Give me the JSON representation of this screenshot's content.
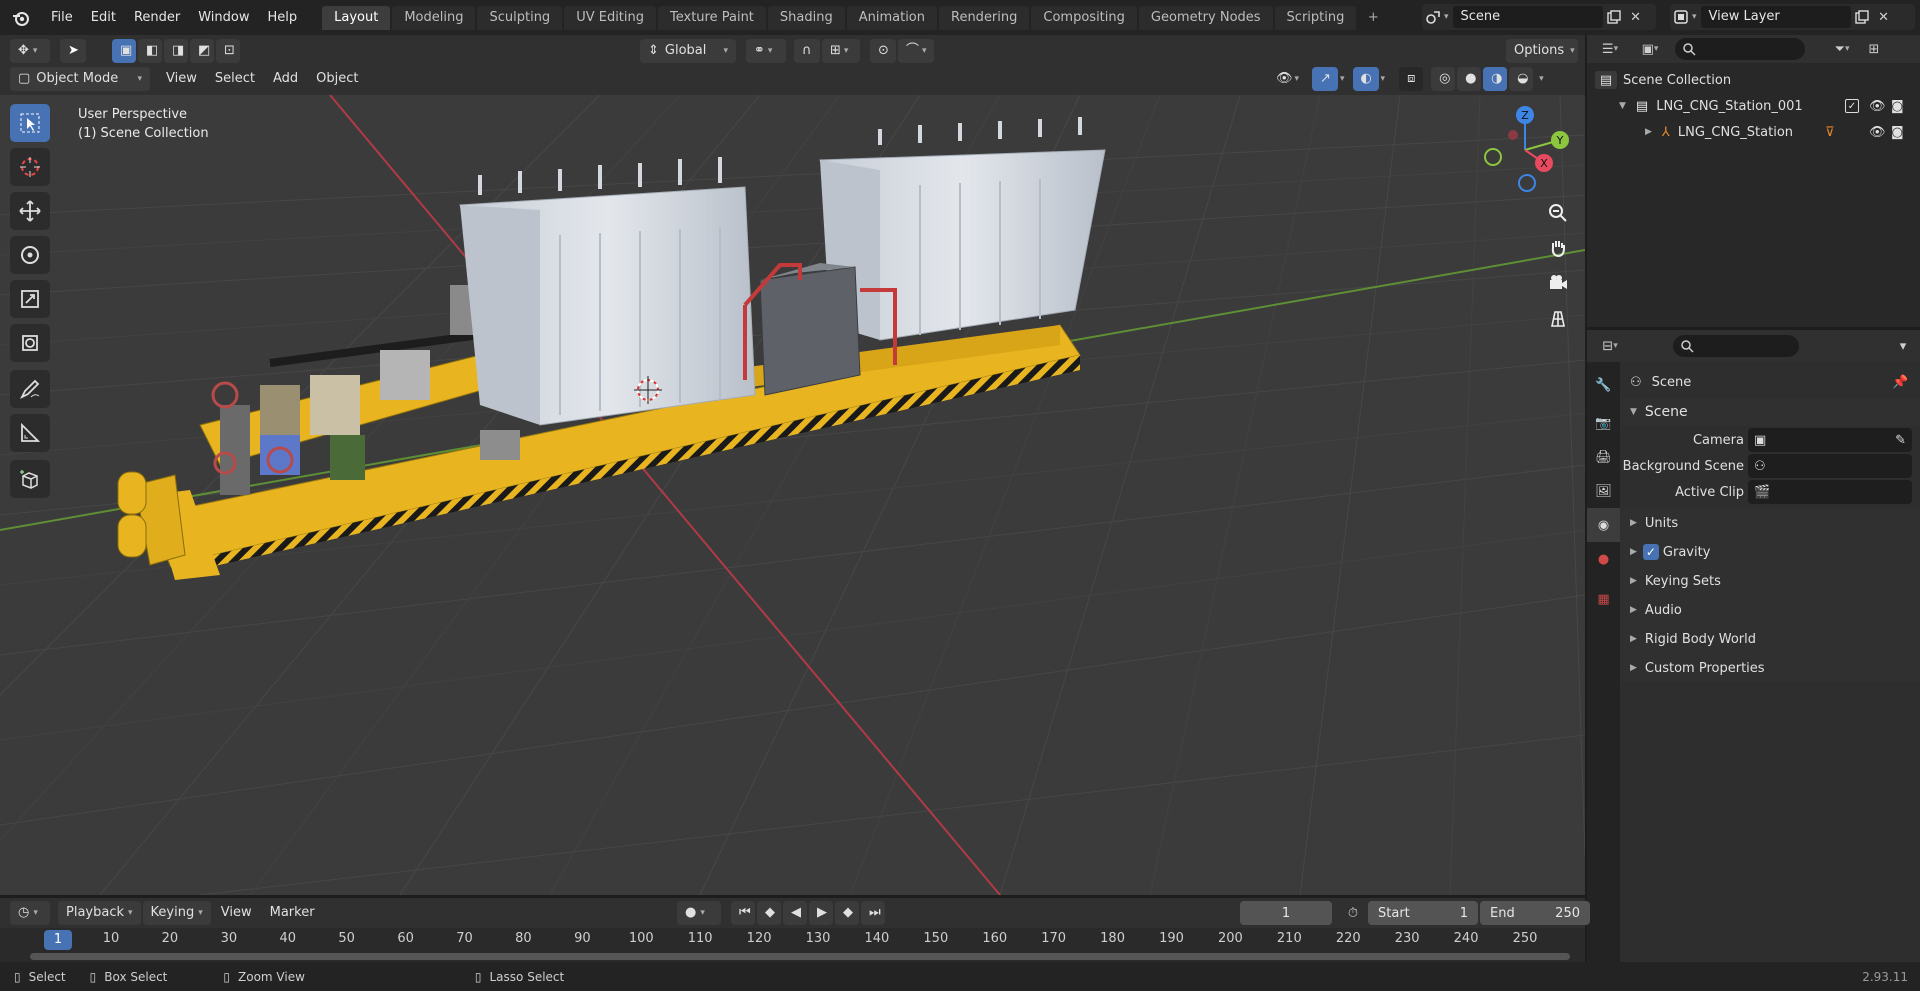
{
  "topbar": {
    "menus": [
      "File",
      "Edit",
      "Render",
      "Window",
      "Help"
    ],
    "workspaces": [
      "Layout",
      "Modeling",
      "Sculpting",
      "UV Editing",
      "Texture Paint",
      "Shading",
      "Animation",
      "Rendering",
      "Compositing",
      "Geometry Nodes",
      "Scripting"
    ],
    "active_workspace": "Layout",
    "scene": "Scene",
    "view_layer": "View Layer"
  },
  "viewport_header": {
    "transform_orientation": "Global",
    "options": "Options",
    "mode": "Object Mode",
    "menus": [
      "View",
      "Select",
      "Add",
      "Object"
    ]
  },
  "viewport": {
    "perspective": "User Perspective",
    "collection": "(1) Scene Collection",
    "gizmo_axes": {
      "x": "X",
      "y": "Y",
      "z": "Z"
    }
  },
  "outliner": {
    "root": "Scene Collection",
    "items": [
      {
        "label": "LNG_CNG_Station_001"
      },
      {
        "label": "LNG_CNG_Station"
      }
    ]
  },
  "properties": {
    "context": "Scene",
    "panel_title": "Scene",
    "fields": [
      {
        "label": "Camera",
        "value": ""
      },
      {
        "label": "Background Scene",
        "value": ""
      },
      {
        "label": "Active Clip",
        "value": ""
      }
    ],
    "sections": [
      "Units",
      "Gravity",
      "Keying Sets",
      "Audio",
      "Rigid Body World",
      "Custom Properties"
    ],
    "gravity_checked": true
  },
  "timeline": {
    "menus": [
      "Playback",
      "Keying",
      "View",
      "Marker"
    ],
    "current_frame": "1",
    "start_label": "Start",
    "start": "1",
    "end_label": "End",
    "end": "250",
    "ticks": [
      "1",
      "10",
      "20",
      "30",
      "40",
      "50",
      "60",
      "70",
      "80",
      "90",
      "100",
      "110",
      "120",
      "130",
      "140",
      "150",
      "160",
      "170",
      "180",
      "190",
      "200",
      "210",
      "220",
      "230",
      "240",
      "250"
    ]
  },
  "statusbar": {
    "select": "Select",
    "box_select": "Box Select",
    "zoom_view": "Zoom View",
    "lasso_select": "Lasso Select",
    "version": "2.93.11"
  },
  "colors": {
    "accent": "#4772b3",
    "x_axis": "#e84a5f",
    "y_axis": "#8cc63f",
    "z_axis": "#3d86e6",
    "platform": "#e8b520",
    "tank": "#d6dbe2"
  }
}
